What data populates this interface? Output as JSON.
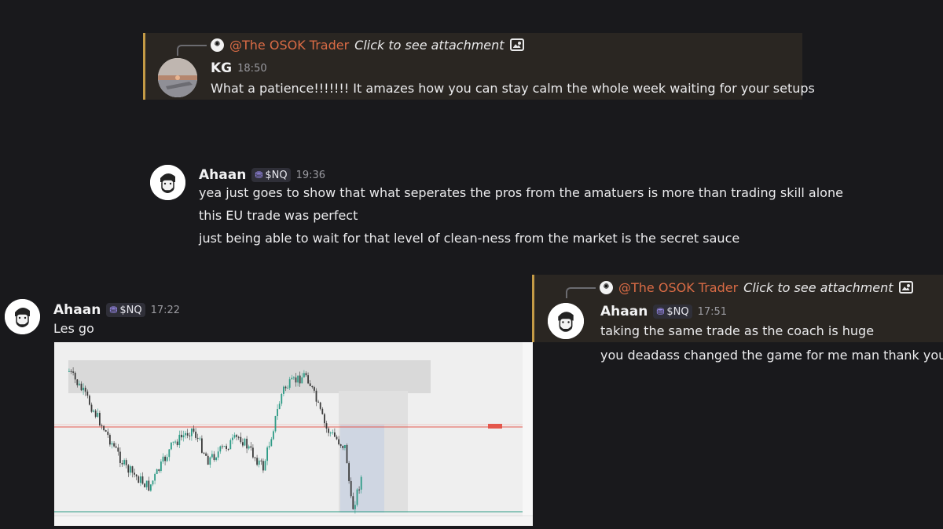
{
  "reply1": {
    "mention": "@The OSOK Trader",
    "click_text": "Click to see attachment",
    "author": "KG",
    "time": "18:50",
    "text": "What a patience!!!!!!! It amazes how you can stay calm the whole week waiting for your setups"
  },
  "message2": {
    "author": "Ahaan",
    "role": "$NQ",
    "time": "19:36",
    "lines": [
      "yea just goes to show that what seperates the pros from the amatuers is more than trading skill alone",
      "this EU trade was perfect",
      "just being able to wait for that level of clean-ness from the market is the secret sauce"
    ]
  },
  "message3": {
    "author": "Ahaan",
    "role": "$NQ",
    "time": "17:22",
    "text": "Les go"
  },
  "reply4": {
    "mention": "@The OSOK Trader",
    "click_text": "Click to see attachment",
    "author": "Ahaan",
    "role": "$NQ",
    "time": "17:51",
    "lines": [
      "taking the same trade as the coach is huge",
      "you deadass changed the game for me man thank you"
    ]
  },
  "colors": {
    "background": "#19191c",
    "highlight": "#2a2622",
    "highlight_border": "#c39a46",
    "mention": "#d96b45",
    "chart_up": "#2e9b86",
    "chart_down": "#3b3b3b",
    "chart_red_line": "#e4574c"
  },
  "icons": [
    "osok-logo-icon",
    "image-icon",
    "role-icon"
  ]
}
